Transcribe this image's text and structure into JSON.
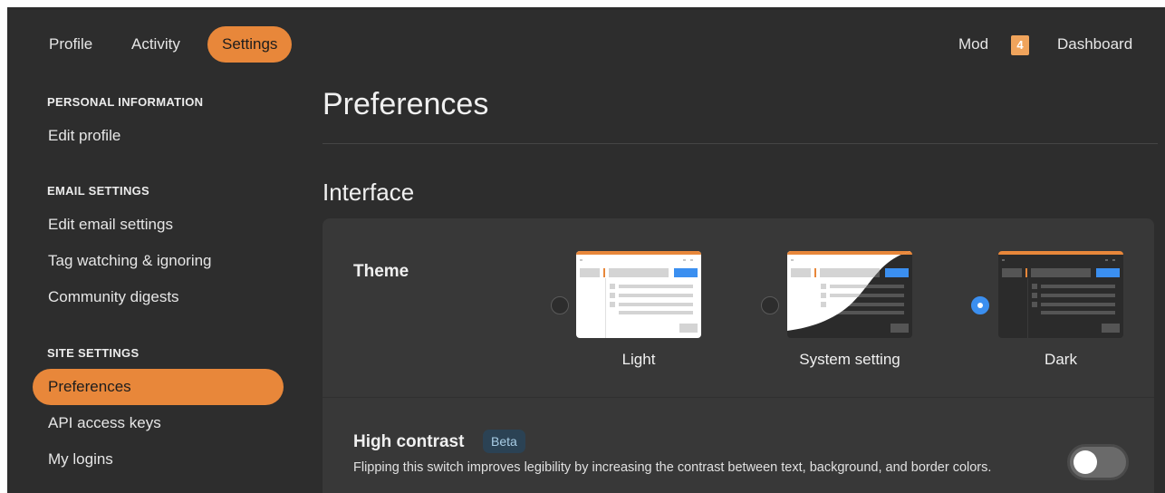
{
  "nav": {
    "tabs": [
      {
        "label": "Profile"
      },
      {
        "label": "Activity"
      },
      {
        "label": "Settings",
        "active": true
      }
    ],
    "mod_label": "Mod",
    "mod_count": "4",
    "dashboard_label": "Dashboard"
  },
  "sidebar": {
    "personal_heading": "PERSONAL INFORMATION",
    "edit_profile": "Edit profile",
    "email_heading": "EMAIL SETTINGS",
    "edit_email": "Edit email settings",
    "tag_watching": "Tag watching & ignoring",
    "community_digests": "Community digests",
    "site_heading": "SITE SETTINGS",
    "preferences": "Preferences",
    "api_keys": "API access keys",
    "my_logins": "My logins"
  },
  "main": {
    "title": "Preferences",
    "section": "Interface",
    "theme_label": "Theme",
    "theme_options": [
      {
        "label": "Light",
        "selected": false
      },
      {
        "label": "System setting",
        "selected": false
      },
      {
        "label": "Dark",
        "selected": true
      }
    ],
    "high_contrast_label": "High contrast",
    "beta_badge": "Beta",
    "high_contrast_desc": "Flipping this switch improves legibility by increasing the contrast between text, background, and border colors.",
    "high_contrast_enabled": false
  },
  "colors": {
    "accent": "#e8873a",
    "background": "#2d2d2d",
    "card": "#383838",
    "radio_selected": "#3b8ff0"
  }
}
